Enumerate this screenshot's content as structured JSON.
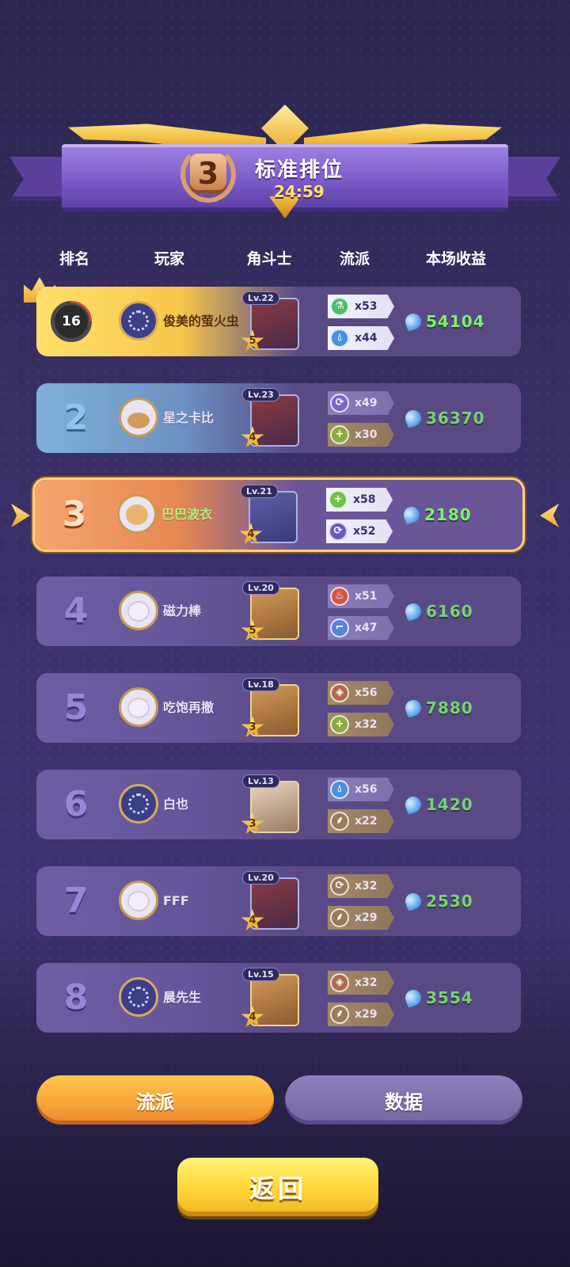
{
  "header": {
    "rank": "3",
    "title": "标准排位",
    "timer": "24:59"
  },
  "columns": [
    "排名",
    "玩家",
    "角斗士",
    "流派",
    "本场收益"
  ],
  "rows": [
    {
      "rank": "1",
      "hp": "16",
      "name": "俊美的萤火虫",
      "level": "Lv.22",
      "stars": "5",
      "traits": [
        {
          "icon": "potion-icon",
          "count": "x53",
          "color": "#4bbf6a"
        },
        {
          "icon": "water-drop-icon",
          "count": "x44",
          "color": "#4a8fe0"
        }
      ],
      "earnings": "54104"
    },
    {
      "rank": "2",
      "name": "星之卡比",
      "level": "Lv.23",
      "stars": "4",
      "traits": [
        {
          "icon": "cycle-icon",
          "count": "x49",
          "color": "#7a66c8"
        },
        {
          "icon": "plus-icon",
          "count": "x30",
          "color": "#8eaa44"
        }
      ],
      "earnings": "36370"
    },
    {
      "rank": "3",
      "name": "巴巴波衣",
      "level": "Lv.21",
      "stars": "4",
      "traits": [
        {
          "icon": "plus-icon",
          "count": "x58",
          "color": "#6cc24a"
        },
        {
          "icon": "cycle-icon",
          "count": "x52",
          "color": "#6a58c2"
        }
      ],
      "earnings": "2180"
    },
    {
      "rank": "4",
      "name": "磁力棒",
      "level": "Lv.20",
      "stars": "5",
      "traits": [
        {
          "icon": "flame-icon",
          "count": "x51",
          "color": "#d0584a"
        },
        {
          "icon": "boot-icon",
          "count": "x47",
          "color": "#5a82d8"
        }
      ],
      "earnings": "6160"
    },
    {
      "rank": "5",
      "name": "吃饱再撤",
      "level": "Lv.18",
      "stars": "3",
      "traits": [
        {
          "icon": "shield-icon",
          "count": "x56",
          "color": "#b06a4a"
        },
        {
          "icon": "plus-icon",
          "count": "x32",
          "color": "#8eaa44"
        }
      ],
      "earnings": "7880"
    },
    {
      "rank": "6",
      "name": "白也",
      "level": "Lv.13",
      "stars": "3",
      "traits": [
        {
          "icon": "water-drop-icon",
          "count": "x56",
          "color": "#4a8fe0"
        },
        {
          "icon": "feather-icon",
          "count": "x22",
          "color": "#9a7a5a"
        }
      ],
      "earnings": "1420"
    },
    {
      "rank": "7",
      "name": "FFF",
      "level": "Lv.20",
      "stars": "4",
      "traits": [
        {
          "icon": "cycle-icon",
          "count": "x32",
          "color": "#9a7a5a"
        },
        {
          "icon": "feather-icon",
          "count": "x29",
          "color": "#9a7a5a"
        }
      ],
      "earnings": "2530"
    },
    {
      "rank": "8",
      "name": "晨先生",
      "level": "Lv.15",
      "stars": "4",
      "traits": [
        {
          "icon": "shield-icon",
          "count": "x32",
          "color": "#b06a4a"
        },
        {
          "icon": "feather-icon",
          "count": "x29",
          "color": "#9a7a5a"
        }
      ],
      "earnings": "3554"
    }
  ],
  "tabs": {
    "active": "流派",
    "inactive": "数据"
  },
  "back_button": "返回"
}
